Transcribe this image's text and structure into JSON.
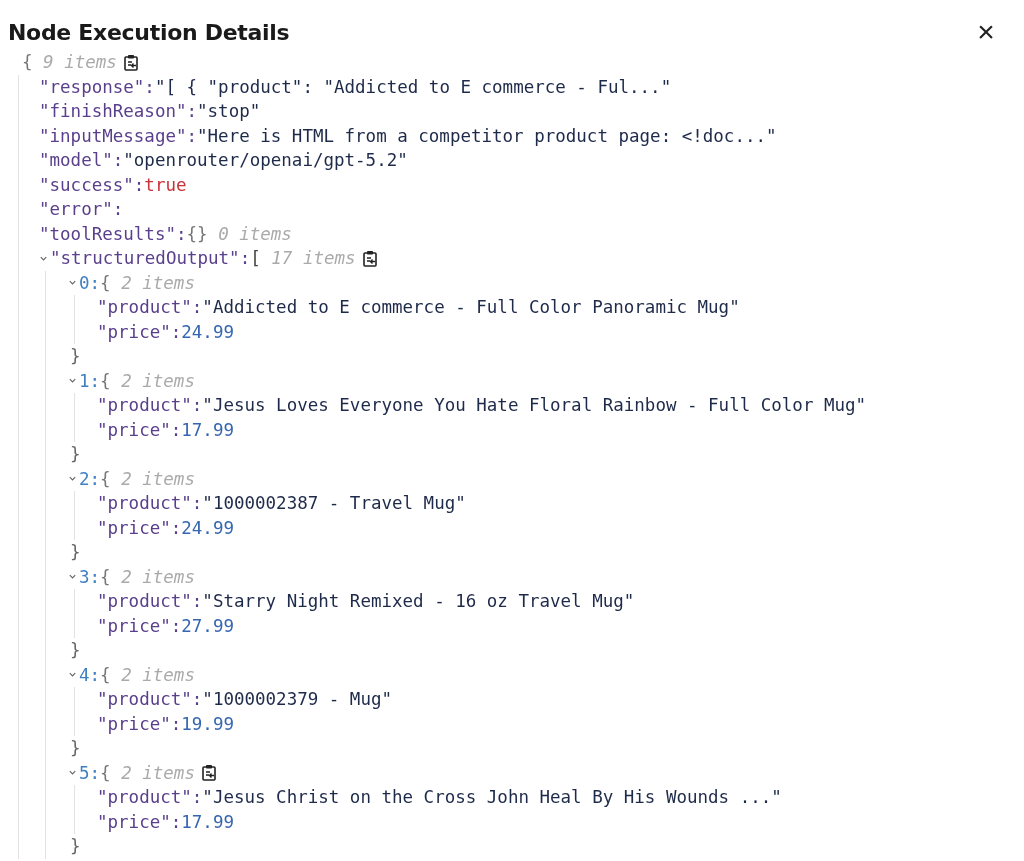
{
  "dialog": {
    "title": "Node Execution Details",
    "close": "×"
  },
  "tree": {
    "open": "{",
    "meta": "9 items",
    "copy": true,
    "children": [
      {
        "key": "\"response\":",
        "kind": "string",
        "value": "\"[ { \"product\": \"Addicted to E commerce - Ful...\""
      },
      {
        "key": "\"finishReason\":",
        "kind": "string",
        "value": "\"stop\""
      },
      {
        "key": "\"inputMessage\":",
        "kind": "string",
        "value": "\"Here is HTML from a competitor product page: <!doc...\""
      },
      {
        "key": "\"model\":",
        "kind": "string",
        "value": "\"openrouter/openai/gpt-5.2\""
      },
      {
        "key": "\"success\":",
        "kind": "boolean",
        "value": "true"
      },
      {
        "key": "\"error\":",
        "kind": "empty"
      },
      {
        "key": "\"toolResults\":",
        "kind": "object",
        "open": "{}",
        "meta": "0 items"
      },
      {
        "key": "\"structuredOutput\":",
        "kind": "array",
        "open": "[",
        "meta": "17 items",
        "copy": true,
        "expanded": true,
        "children": [
          {
            "key": "0:",
            "kind": "object",
            "open": "{",
            "meta": "2 items",
            "expanded": true,
            "close": "}",
            "children": [
              {
                "key": "\"product\":",
                "kind": "string",
                "value": "\"Addicted to E commerce - Full Color Panoramic Mug\""
              },
              {
                "key": "\"price\":",
                "kind": "number",
                "value": "24.99"
              }
            ]
          },
          {
            "key": "1:",
            "kind": "object",
            "open": "{",
            "meta": "2 items",
            "expanded": true,
            "close": "}",
            "children": [
              {
                "key": "\"product\":",
                "kind": "string",
                "value": "\"Jesus Loves Everyone You Hate Floral Rainbow - Full Color Mug\""
              },
              {
                "key": "\"price\":",
                "kind": "number",
                "value": "17.99"
              }
            ]
          },
          {
            "key": "2:",
            "kind": "object",
            "open": "{",
            "meta": "2 items",
            "expanded": true,
            "close": "}",
            "children": [
              {
                "key": "\"product\":",
                "kind": "string",
                "value": "\"1000002387 - Travel Mug\""
              },
              {
                "key": "\"price\":",
                "kind": "number",
                "value": "24.99"
              }
            ]
          },
          {
            "key": "3:",
            "kind": "object",
            "open": "{",
            "meta": "2 items",
            "expanded": true,
            "close": "}",
            "children": [
              {
                "key": "\"product\":",
                "kind": "string",
                "value": "\"Starry Night Remixed - 16 oz Travel Mug\""
              },
              {
                "key": "\"price\":",
                "kind": "number",
                "value": "27.99"
              }
            ]
          },
          {
            "key": "4:",
            "kind": "object",
            "open": "{",
            "meta": "2 items",
            "expanded": true,
            "close": "}",
            "children": [
              {
                "key": "\"product\":",
                "kind": "string",
                "value": "\"1000002379 - Mug\""
              },
              {
                "key": "\"price\":",
                "kind": "number",
                "value": "19.99"
              }
            ]
          },
          {
            "key": "5:",
            "kind": "object",
            "open": "{",
            "meta": "2 items",
            "copy": true,
            "expanded": true,
            "close": "}",
            "children": [
              {
                "key": "\"product\":",
                "kind": "string",
                "value": "\"Jesus Christ on the Cross John Heal By His Wounds ...\""
              },
              {
                "key": "\"price\":",
                "kind": "number",
                "value": "17.99"
              }
            ]
          }
        ]
      }
    ]
  }
}
